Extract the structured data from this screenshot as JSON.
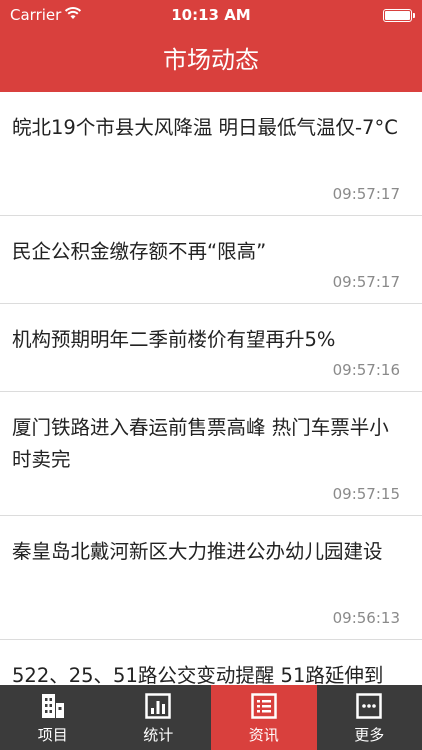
{
  "status_bar": {
    "carrier": "Carrier",
    "time": "10:13 AM"
  },
  "nav": {
    "title": "市场动态"
  },
  "news": [
    {
      "title": "皖北19个市县大风降温 明日最低气温仅-7°C",
      "time": "09:57:17"
    },
    {
      "title": "民企公积金缴存额不再“限高”",
      "time": "09:57:17"
    },
    {
      "title": "机构预期明年二季前楼价有望再升5%",
      "time": "09:57:16"
    },
    {
      "title": "厦门铁路进入春运前售票高峰 热门车票半小时卖完",
      "time": "09:57:15"
    },
    {
      "title": "秦皇岛北戴河新区大力推进公办幼儿园建设",
      "time": "09:56:13"
    },
    {
      "title": "522、25、51路公交变动提醒 51路延伸到",
      "time": ""
    }
  ],
  "tabs": [
    {
      "label": "项目",
      "icon": "building-icon"
    },
    {
      "label": "统计",
      "icon": "bar-chart-icon"
    },
    {
      "label": "资讯",
      "icon": "list-icon",
      "active": true
    },
    {
      "label": "更多",
      "icon": "more-icon"
    }
  ],
  "colors": {
    "brand_red": "#d9403d",
    "tabbar_bg": "#3b3b3b",
    "timestamp": "#8a8a8a"
  }
}
